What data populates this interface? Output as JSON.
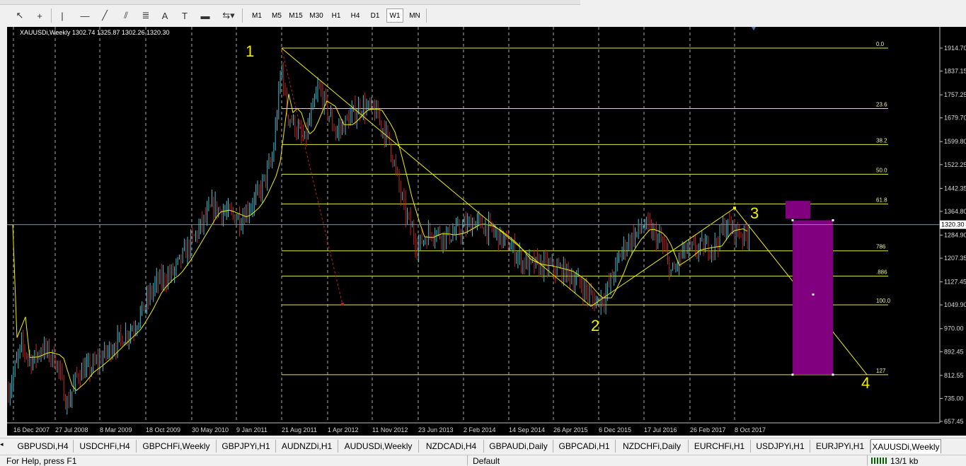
{
  "toolbar": {
    "tools": [
      {
        "name": "cursor-icon",
        "glyph": "↖"
      },
      {
        "name": "crosshair-icon",
        "glyph": "+"
      },
      {
        "name": "vertical-line-icon",
        "glyph": "|"
      },
      {
        "name": "horizontal-line-icon",
        "glyph": "—"
      },
      {
        "name": "trendline-icon",
        "glyph": "╱"
      },
      {
        "name": "channel-icon",
        "glyph": "⫽"
      },
      {
        "name": "fibonacci-icon",
        "glyph": "≣"
      },
      {
        "name": "text-icon",
        "glyph": "A"
      },
      {
        "name": "text-label-icon",
        "glyph": "T"
      },
      {
        "name": "rectangle-icon",
        "glyph": "▬"
      },
      {
        "name": "shapes-dropdown-icon",
        "glyph": "⇆▾"
      }
    ],
    "timeframes": [
      "M1",
      "M5",
      "M15",
      "M30",
      "H1",
      "H4",
      "D1",
      "W1",
      "MN"
    ],
    "active_timeframe": "W1"
  },
  "chart": {
    "header": "XAUUSDi,Weekly  1302.74 1325.87 1302.26 1320.30",
    "current_price": "1320.30",
    "price_labels": [
      "1914.70",
      "1837.15",
      "1757.25",
      "1679.70",
      "1599.80",
      "1522.25",
      "1442.35",
      "1364.80",
      "1284.90",
      "1207.35",
      "1127.45",
      "1049.90",
      "970.00",
      "892.45",
      "812.55",
      "735.00",
      "657.45"
    ],
    "date_labels": [
      "16 Dec 2007",
      "27 Jul 2008",
      "8 Mar 2009",
      "18 Oct 2009",
      "30 May 2010",
      "9 Jan 2011",
      "21 Aug 2011",
      "1 Apr 2012",
      "11 Nov 2012",
      "23 Jun 2013",
      "2 Feb 2014",
      "14 Sep 2014",
      "26 Apr 2015",
      "6 Dec 2015",
      "17 Jul 2016",
      "26 Feb 2017",
      "8 Oct 2017"
    ],
    "fib_levels": [
      {
        "label": "0.0",
        "price": 1914.7
      },
      {
        "label": "23.6",
        "price": 1711
      },
      {
        "label": "38.2",
        "price": 1590
      },
      {
        "label": "50.0",
        "price": 1490
      },
      {
        "label": "61.8",
        "price": 1390
      },
      {
        "label": "786",
        "price": 1232
      },
      {
        "label": ".886",
        "price": 1147
      },
      {
        "label": "100.0",
        "price": 1050
      },
      {
        "label": "127",
        "price": 815
      }
    ],
    "wave_labels": [
      "1",
      "2",
      "3",
      "4"
    ],
    "colors": {
      "background": "#000000",
      "bull": "#40c0d0",
      "bear": "#c02828",
      "ma": "#f0f000",
      "fib": "#e8e840",
      "zone": "#800080",
      "wave": "#f0f000",
      "projection": "#c02020"
    }
  },
  "tabs": [
    "GBPUSDi,H4",
    "USDCHFi,H4",
    "GBPCHFi,Weekly",
    "GBPJPYi,H1",
    "AUDNZDi,H1",
    "AUDUSDi,Weekly",
    "NZDCADi,H4",
    "GBPAUDi,Daily",
    "GBPCADi,H1",
    "NZDCHFi,Daily",
    "EURCHFi,H1",
    "USDJPYi,H1",
    "EURJPYi,H1",
    "XAUUSDi,Weekly"
  ],
  "active_tab": "XAUUSDi,Weekly",
  "status": {
    "help": "For Help, press F1",
    "profile": "Default",
    "connection": "13/1 kb"
  }
}
